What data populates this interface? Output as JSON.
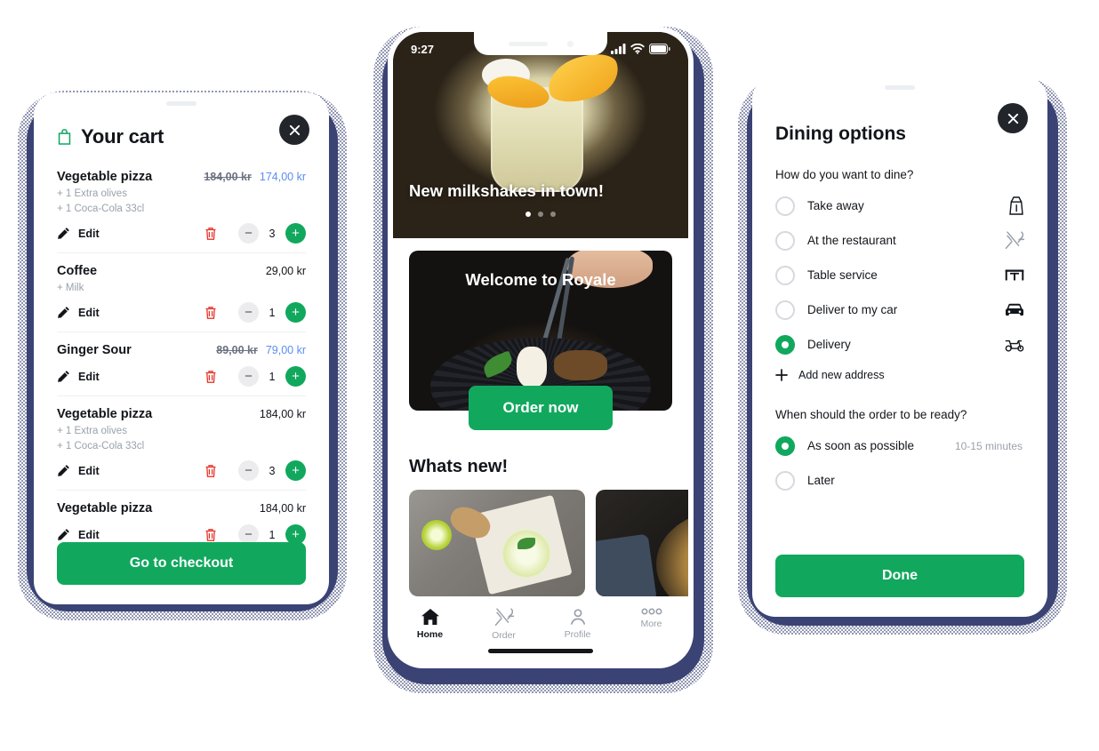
{
  "theme": {
    "green": "#11a85e",
    "navy_shadow": "#3a4374",
    "blue_price": "#5b8def",
    "dark": "#12151a",
    "muted": "#9aa1ab",
    "red": "#e8342a"
  },
  "cart": {
    "title": "Your cart",
    "bag_icon": "shopping-bag-icon",
    "close_icon": "close-icon",
    "edit_label": "Edit",
    "checkout_label": "Go to checkout",
    "items": [
      {
        "name": "Vegetable pizza",
        "price_old": "184,00 kr",
        "price_new": "174,00 kr",
        "addons": [
          "+ 1 Extra olives",
          "+ 1 Coca-Cola 33cl"
        ],
        "qty": "3"
      },
      {
        "name": "Coffee",
        "price_old": "",
        "price_new": "29,00 kr",
        "addons": [
          "+ Milk"
        ],
        "qty": "1"
      },
      {
        "name": "Ginger Sour",
        "price_old": "89,00 kr",
        "price_new": "79,00 kr",
        "addons": [],
        "qty": "1"
      },
      {
        "name": "Vegetable pizza",
        "price_old": "",
        "price_new": "184,00 kr",
        "addons": [
          "+ 1 Extra olives",
          "+ 1 Coca-Cola 33cl"
        ],
        "qty": "3"
      },
      {
        "name": "Vegetable pizza",
        "price_old": "",
        "price_new": "184,00 kr",
        "addons": [],
        "qty": "1"
      }
    ]
  },
  "home": {
    "statusbar": {
      "time": "9:27",
      "signal_icon": "cellular-signal-icon",
      "wifi_icon": "wifi-icon",
      "battery_icon": "battery-icon"
    },
    "hero": {
      "title": "New milkshakes in town!",
      "dots_total": 3,
      "dot_active": 0
    },
    "welcome": {
      "title": "Welcome to Royale",
      "cta_label": "Order now"
    },
    "whats_new": {
      "title": "Whats new!"
    },
    "tabs": [
      {
        "label": "Home",
        "icon": "home-icon",
        "active": true
      },
      {
        "label": "Order",
        "icon": "cutlery-icon",
        "active": false
      },
      {
        "label": "Profile",
        "icon": "person-icon",
        "active": false
      },
      {
        "label": "More",
        "icon": "more-dots-icon",
        "active": false
      }
    ]
  },
  "dining": {
    "title": "Dining options",
    "close_icon": "close-icon",
    "question_1": "How do you want to dine?",
    "options": [
      {
        "label": "Take away",
        "icon": "takeaway-bag-icon",
        "selected": false,
        "meta": ""
      },
      {
        "label": "At the restaurant",
        "icon": "cutlery-icon",
        "selected": false,
        "meta": ""
      },
      {
        "label": "Table service",
        "icon": "table-service-icon",
        "selected": false,
        "meta": ""
      },
      {
        "label": "Deliver to my car",
        "icon": "car-icon",
        "selected": false,
        "meta": ""
      },
      {
        "label": "Delivery",
        "icon": "scooter-icon",
        "selected": true,
        "meta": ""
      }
    ],
    "add_address_label": "Add new address",
    "add_icon": "plus-icon",
    "question_2": "When should the order to be ready?",
    "timing": [
      {
        "label": "As soon as possible",
        "selected": true,
        "meta": "10-15 minutes"
      },
      {
        "label": "Later",
        "selected": false,
        "meta": ""
      }
    ],
    "done_label": "Done"
  }
}
